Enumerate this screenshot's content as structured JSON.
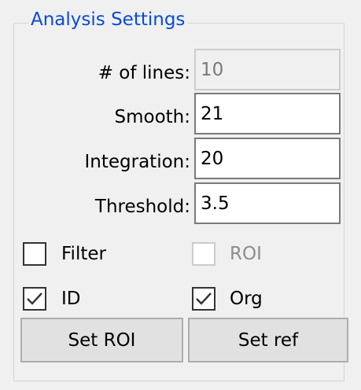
{
  "group": {
    "title": "Analysis Settings"
  },
  "fields": {
    "lines": {
      "label": "# of lines:",
      "value": "10",
      "enabled": false
    },
    "smooth": {
      "label": "Smooth:",
      "value": "21",
      "enabled": true
    },
    "integration": {
      "label": "Integration:",
      "value": "20",
      "enabled": true
    },
    "threshold": {
      "label": "Threshold:",
      "value": "3.5",
      "enabled": true
    }
  },
  "checkboxes": {
    "filter": {
      "label": "Filter",
      "checked": false,
      "enabled": true
    },
    "roi": {
      "label": "ROI",
      "checked": false,
      "enabled": false
    },
    "id": {
      "label": "ID",
      "checked": true,
      "enabled": true
    },
    "org": {
      "label": "Org",
      "checked": true,
      "enabled": true
    }
  },
  "buttons": {
    "set_roi": "Set ROI",
    "set_ref": "Set ref"
  },
  "colors": {
    "group_title": "#0a4bd6",
    "window_bg": "#f0f0f0",
    "button_bg": "#e1e1e1",
    "disabled_text": "#8d8d8d"
  },
  "icons": {
    "check": "checkmark-icon"
  }
}
